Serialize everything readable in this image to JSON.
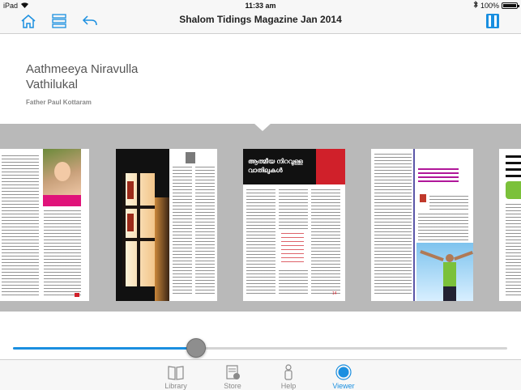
{
  "status_bar": {
    "device": "iPad",
    "time": "11:33 am",
    "battery": "100%"
  },
  "nav": {
    "title": "Shalom Tidings Magazine Jan 2014",
    "icons": [
      "home-icon",
      "list-icon",
      "back-arrow-icon",
      "thumbnails-icon"
    ]
  },
  "article": {
    "title_line1": "Aathmeeya Niravulla",
    "title_line2": "Vathilukal",
    "author": "Father Paul Kottaram"
  },
  "pages": {
    "p3_headline": "ആത്മീയ നിറവുള്ള വാതിലുകൾ",
    "p3_page_number": "14"
  },
  "slider": {
    "progress": 0.37
  },
  "tabbar": {
    "items": [
      {
        "label": "Library",
        "icon": "book-icon"
      },
      {
        "label": "Store",
        "icon": "store-icon"
      },
      {
        "label": "Help",
        "icon": "help-person-icon"
      },
      {
        "label": "Viewer",
        "icon": "viewer-icon",
        "active": true
      }
    ]
  },
  "colors": {
    "accent": "#1a8fe0",
    "strip": "#b9b9b9",
    "magenta": "#e0137a",
    "red": "#d0202a"
  }
}
